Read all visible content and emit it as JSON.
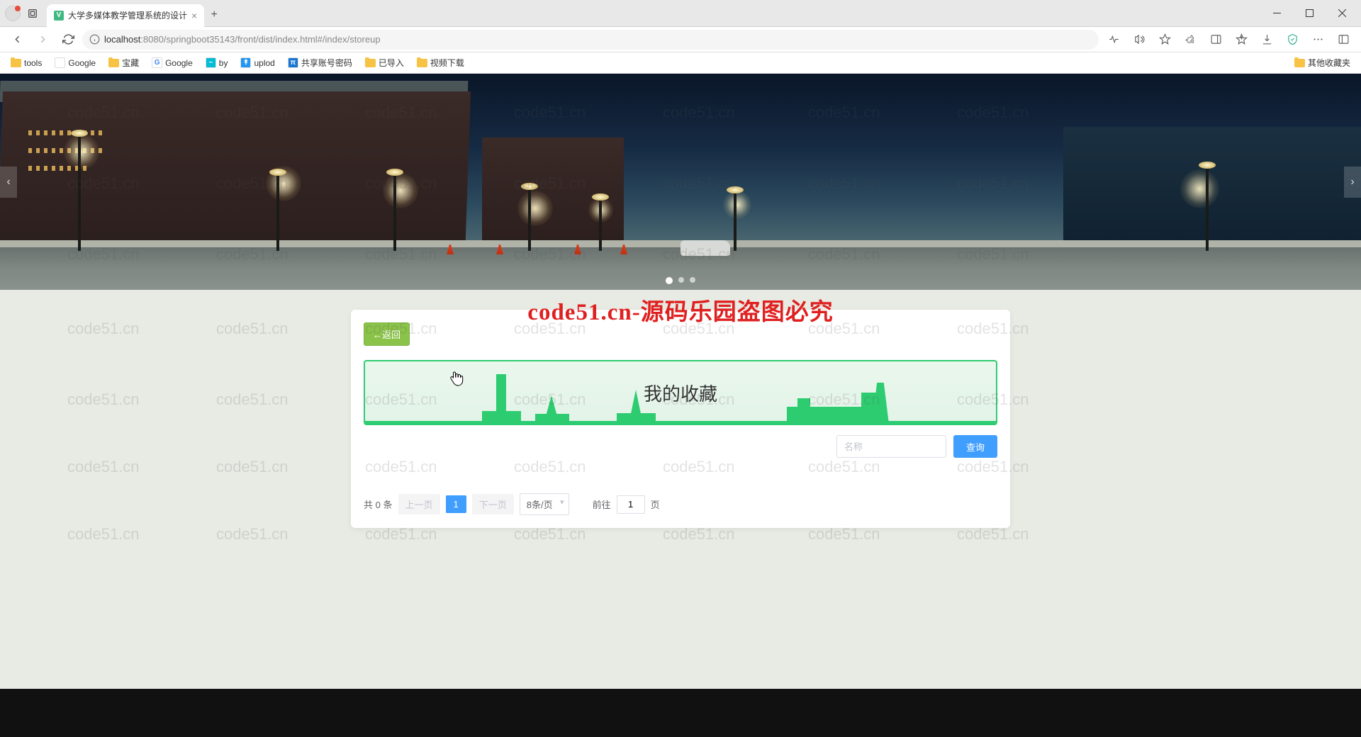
{
  "browser": {
    "tab_title": "大学多媒体教学管理系统的设计",
    "url_host": "localhost",
    "url_port": ":8080",
    "url_path": "/springboot35143/front/dist/index.html#/index/storeup",
    "bookmarks": [
      {
        "label": "tools",
        "type": "folder"
      },
      {
        "label": "Google",
        "type": "link",
        "icon_bg": "#ffffff",
        "icon_text": "",
        "icon_color": "#555"
      },
      {
        "label": "宝藏",
        "type": "folder"
      },
      {
        "label": "Google",
        "type": "link",
        "icon_bg": "#ffffff",
        "icon_text": "G",
        "icon_color": "#4285f4"
      },
      {
        "label": "by",
        "type": "link",
        "icon_bg": "#00bcd4",
        "icon_text": "~",
        "icon_color": "#fff"
      },
      {
        "label": "uplod",
        "type": "link",
        "icon_bg": "#2196f3",
        "icon_text": "↟",
        "icon_color": "#fff"
      },
      {
        "label": "共享账号密码",
        "type": "link",
        "icon_bg": "#1976d2",
        "icon_text": "π",
        "icon_color": "#fff"
      },
      {
        "label": "已导入",
        "type": "folder"
      },
      {
        "label": "视频下载",
        "type": "folder"
      }
    ],
    "other_bookmarks": "其他收藏夹"
  },
  "watermark": {
    "tile_text": "code51.cn",
    "center_text": "code51.cn-源码乐园盗图必究"
  },
  "page": {
    "back_button": "←返回",
    "title": "我的收藏",
    "search_placeholder": "名称",
    "search_button": "查询",
    "pagination": {
      "total_prefix": "共",
      "total_count": "0",
      "total_suffix": "条",
      "prev": "上一页",
      "current_page": "1",
      "next": "下一页",
      "page_size": "8条/页",
      "goto_prefix": "前往",
      "goto_value": "1",
      "goto_suffix": "页"
    }
  }
}
